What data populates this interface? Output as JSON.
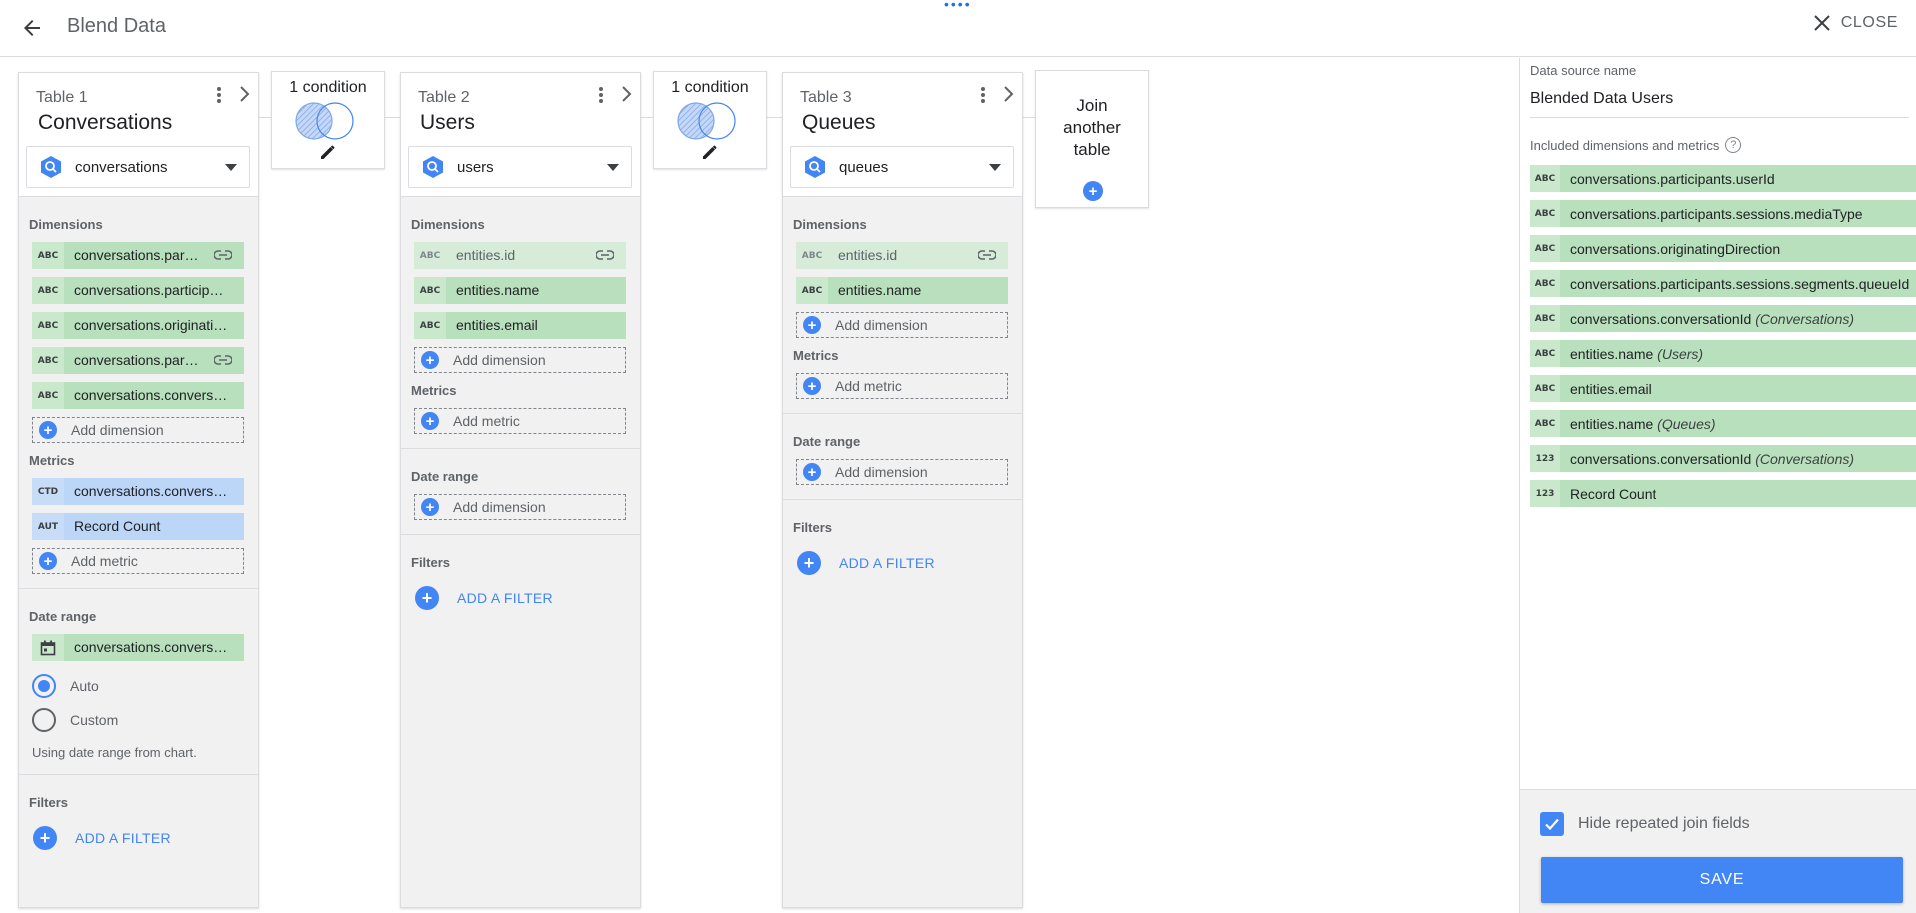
{
  "header": {
    "title": "Blend Data",
    "close_label": "CLOSE"
  },
  "tables": [
    {
      "label": "Table 1",
      "name": "Conversations",
      "source": "conversations",
      "dimensions_heading": "Dimensions",
      "dimensions": [
        {
          "type": "ABC",
          "name": "conversations.participants.userId",
          "display": "conversations.par…",
          "join": true
        },
        {
          "type": "ABC",
          "name": "conversations.participants.sessions.mediaType",
          "display": "conversations.particip…",
          "join": false
        },
        {
          "type": "ABC",
          "name": "conversations.originatingDirection",
          "display": "conversations.originati…",
          "join": false
        },
        {
          "type": "ABC",
          "name": "conversations.participants.sessions.segments.queueId",
          "display": "conversations.par…",
          "join": true
        },
        {
          "type": "ABC",
          "name": "conversations.conversationId",
          "display": "conversations.convers…",
          "join": false
        }
      ],
      "add_dimension": "Add dimension",
      "metrics_heading": "Metrics",
      "metrics": [
        {
          "type": "CTD",
          "name": "conversations.convers…"
        },
        {
          "type": "AUT",
          "name": "Record Count"
        }
      ],
      "add_metric": "Add metric",
      "date_heading": "Date range",
      "date_field": "conversations.convers…",
      "radio_auto": "Auto",
      "radio_custom": "Custom",
      "date_note": "Using date range from chart.",
      "filters_heading": "Filters",
      "add_filter": "ADD A FILTER"
    },
    {
      "label": "Table 2",
      "name": "Users",
      "source": "users",
      "dimensions_heading": "Dimensions",
      "dimensions": [
        {
          "type": "ABC",
          "name": "entities.id",
          "join": true
        },
        {
          "type": "ABC",
          "name": "entities.name",
          "join": false
        },
        {
          "type": "ABC",
          "name": "entities.email",
          "join": false
        }
      ],
      "add_dimension": "Add dimension",
      "metrics_heading": "Metrics",
      "add_metric": "Add metric",
      "date_heading": "Date range",
      "date_add": "Add dimension",
      "filters_heading": "Filters",
      "add_filter": "ADD A FILTER"
    },
    {
      "label": "Table 3",
      "name": "Queues",
      "source": "queues",
      "dimensions_heading": "Dimensions",
      "dimensions": [
        {
          "type": "ABC",
          "name": "entities.id",
          "join": true
        },
        {
          "type": "ABC",
          "name": "entities.name",
          "join": false
        }
      ],
      "add_dimension": "Add dimension",
      "metrics_heading": "Metrics",
      "add_metric": "Add metric",
      "date_heading": "Date range",
      "date_add": "Add dimension",
      "filters_heading": "Filters",
      "add_filter": "ADD A FILTER"
    }
  ],
  "conditions": [
    "1 condition",
    "1 condition"
  ],
  "join_another": [
    "Join",
    "another",
    "table"
  ],
  "sidebar": {
    "ds_label": "Data source name",
    "ds_value": "Blended Data Users",
    "included_label": "Included dimensions and metrics",
    "help": "?",
    "included": [
      {
        "type": "ABC",
        "name": "conversations.participants.userId",
        "qualifier": ""
      },
      {
        "type": "ABC",
        "name": "conversations.participants.sessions.mediaType",
        "qualifier": ""
      },
      {
        "type": "ABC",
        "name": "conversations.originatingDirection",
        "qualifier": ""
      },
      {
        "type": "ABC",
        "name": "conversations.participants.sessions.segments.queueId",
        "qualifier": ""
      },
      {
        "type": "ABC",
        "name": "conversations.conversationId ",
        "qualifier": "(Conversations)"
      },
      {
        "type": "ABC",
        "name": "entities.name ",
        "qualifier": "(Users)"
      },
      {
        "type": "ABC",
        "name": "entities.email",
        "qualifier": ""
      },
      {
        "type": "ABC",
        "name": "entities.name ",
        "qualifier": "(Queues)"
      },
      {
        "type": "123",
        "name": "conversations.conversationId ",
        "qualifier": "(Conversations)"
      },
      {
        "type": "123",
        "name": "Record Count",
        "qualifier": ""
      }
    ],
    "hide_label": "Hide repeated join fields",
    "save_label": "SAVE"
  },
  "colors": {
    "accent": "#4285f4",
    "dimension": "#b9e0bd",
    "metric": "#bcd6f7",
    "panel": "#f1f1f1"
  }
}
